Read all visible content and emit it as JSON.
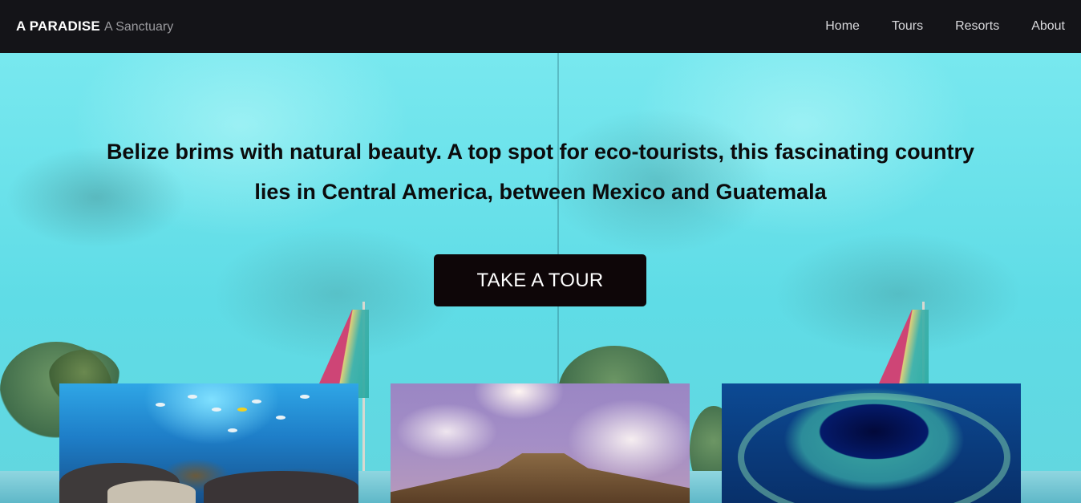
{
  "navbar": {
    "brand_title": "A PARADISE",
    "brand_subtitle": "A Sanctuary",
    "links": [
      "Home",
      "Tours",
      "Resorts",
      "About"
    ]
  },
  "hero": {
    "headline": "Belize brims with natural beauty. A top spot for eco-tourists, this fascinating country lies in Central America, between Mexico and Guatemala",
    "cta_label": "TAKE A TOUR"
  },
  "colors": {
    "navbar_bg": "#141418",
    "hero_bg": "#62d6df",
    "cta_bg": "#0e0608",
    "cta_text": "#ffffff"
  }
}
